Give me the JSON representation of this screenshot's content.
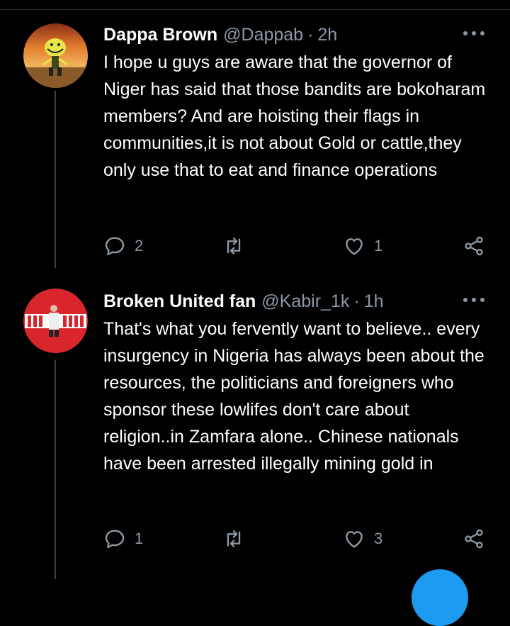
{
  "theme": {
    "background": "#000000",
    "text": "#ffffff",
    "muted": "#8b98a5",
    "accent": "#1d9bf0",
    "thread_line": "#3d4145"
  },
  "tweets": [
    {
      "name": "Dappa Brown",
      "handle": "@Dappab",
      "separator": "·",
      "time": "2h",
      "text": "I hope u guys are aware that the governor of Niger has said that those bandits are bokoharam members? And are hoisting their flags in communities,it is not about Gold or cattle,they only use that to eat and finance operations",
      "replies": "2",
      "retweets": "",
      "likes": "1",
      "avatar_icon": "cartoon-avatar-icon"
    },
    {
      "name": "Broken United fan",
      "handle": "@Kabir_1k",
      "separator": "·",
      "time": "1h",
      "text": "That's what you fervently want to believe.. every insurgency in Nigeria has always been about the resources, the politicians and foreigners who sponsor these lowlifes don't care about religion..in Zamfara alone.. Chinese nationals have been arrested illegally mining gold in",
      "replies": "1",
      "retweets": "",
      "likes": "3",
      "avatar_icon": "red-circle-avatar-icon"
    }
  ],
  "icons": [
    "reply-icon",
    "retweet-icon",
    "like-icon",
    "share-icon",
    "more-icon",
    "compose-fab-icon"
  ]
}
